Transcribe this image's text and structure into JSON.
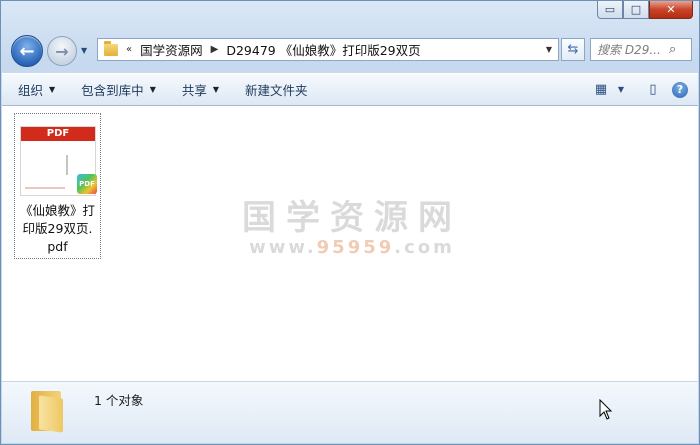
{
  "window": {
    "caption_buttons": {
      "minimize": "▭",
      "maximize": "□",
      "close": "✕"
    }
  },
  "nav": {
    "back_icon": "←",
    "forward_icon": "→",
    "breadcrumb_chevron": "«",
    "breadcrumb": [
      "国学资源网",
      "D29479 《仙娘教》打印版29双页"
    ],
    "crumb_sep": "▶",
    "refresh_icon": "⇆",
    "search_placeholder": "搜索 D29...",
    "search_icon": "⌕"
  },
  "toolbar": {
    "organize": "组织",
    "include_library": "包含到库中",
    "share": "共享",
    "new_folder": "新建文件夹",
    "view_icon": "▦",
    "preview_icon": "▯",
    "help_icon": "?"
  },
  "files": [
    {
      "name_line1": "《仙娘教》打",
      "name_line2": "印版29双页.",
      "name_line3": "pdf",
      "thumb_label": "PDF",
      "badge": "PDF"
    }
  ],
  "watermark": {
    "line1": "国学资源网",
    "line2_prefix": "www.",
    "line2_highlight": "95959",
    "line2_suffix": ".com"
  },
  "details": {
    "count": "1 个对象"
  }
}
